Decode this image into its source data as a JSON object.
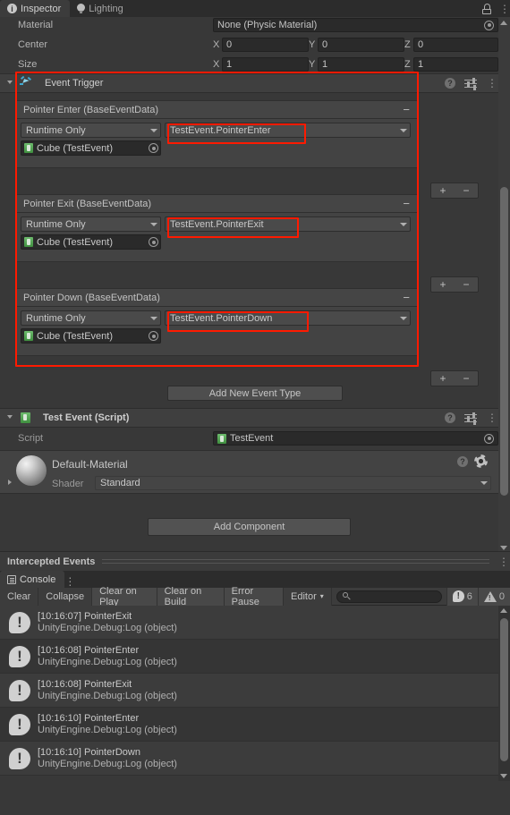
{
  "window": {
    "tabs": [
      {
        "label": "Inspector",
        "icon": "info-icon",
        "active": true
      },
      {
        "label": "Lighting",
        "icon": "lightbulb-icon",
        "active": false
      }
    ],
    "lock_icon": "padlock-icon",
    "menu_icon": "kebab-menu-icon"
  },
  "collider": {
    "rows": [
      {
        "label": "Material",
        "value": "None (Physic Material)",
        "type": "object"
      },
      {
        "label": "Center",
        "axes": [
          {
            "axis": "X",
            "value": "0"
          },
          {
            "axis": "Y",
            "value": "0"
          },
          {
            "axis": "Z",
            "value": "0"
          }
        ]
      },
      {
        "label": "Size",
        "axes": [
          {
            "axis": "X",
            "value": "1"
          },
          {
            "axis": "Y",
            "value": "1"
          },
          {
            "axis": "Z",
            "value": "1"
          }
        ]
      }
    ]
  },
  "event_trigger": {
    "title": "Event Trigger",
    "icon": "event-trigger-cursor-icon",
    "header_icons": [
      "help-icon",
      "preset-icon",
      "kebab-menu-icon"
    ],
    "events": [
      {
        "name": "Pointer Enter (BaseEventData)",
        "mode": "Runtime Only",
        "function": "TestEvent.PointerEnter",
        "target": "Cube (TestEvent)",
        "remove_label": "−",
        "highlighted": true
      },
      {
        "name": "Pointer Exit (BaseEventData)",
        "mode": "Runtime Only",
        "function": "TestEvent.PointerExit",
        "target": "Cube (TestEvent)",
        "remove_label": "−",
        "highlighted": true
      },
      {
        "name": "Pointer Down (BaseEventData)",
        "mode": "Runtime Only",
        "function": "TestEvent.PointerDown",
        "target": "Cube (TestEvent)",
        "remove_label": "−",
        "highlighted": true
      }
    ],
    "plus_label": "+",
    "minus_label": "−",
    "add_event_type_button": "Add New Event Type",
    "highlight_color": "#ff1a00"
  },
  "test_event_script": {
    "title": "Test Event (Script)",
    "icon": "csharp-script-icon",
    "script_label": "Script",
    "script_value": "TestEvent",
    "header_icons": [
      "help-icon",
      "preset-icon",
      "kebab-menu-icon"
    ]
  },
  "material": {
    "name": "Default-Material",
    "shader_label": "Shader",
    "shader_value": "Standard",
    "header_icons": [
      "help-icon",
      "gear-icon"
    ]
  },
  "add_component": {
    "label": "Add Component"
  },
  "intercepted_events": {
    "label": "Intercepted Events",
    "menu_icon": "kebab-menu-icon"
  },
  "console": {
    "tab_label": "Console",
    "tab_icon": "console-lines-icon",
    "menu_icon": "kebab-menu-icon",
    "toolbar": {
      "clear": "Clear",
      "collapse": "Collapse",
      "clear_on_play": "Clear on Play",
      "clear_on_build": "Clear on Build",
      "error_pause": "Error Pause",
      "editor": "Editor",
      "editor_caret": "▾",
      "search_placeholder": "",
      "search_icon": "search-icon",
      "log_count": "6",
      "warning_count": "0"
    },
    "entries": [
      {
        "time": "[10:16:07]",
        "message": "PointerExit",
        "stack": "UnityEngine.Debug:Log (object)"
      },
      {
        "time": "[10:16:08]",
        "message": "PointerEnter",
        "stack": "UnityEngine.Debug:Log (object)"
      },
      {
        "time": "[10:16:08]",
        "message": "PointerExit",
        "stack": "UnityEngine.Debug:Log (object)"
      },
      {
        "time": "[10:16:10]",
        "message": "PointerEnter",
        "stack": "UnityEngine.Debug:Log (object)"
      },
      {
        "time": "[10:16:10]",
        "message": "PointerDown",
        "stack": "UnityEngine.Debug:Log (object)"
      }
    ]
  }
}
